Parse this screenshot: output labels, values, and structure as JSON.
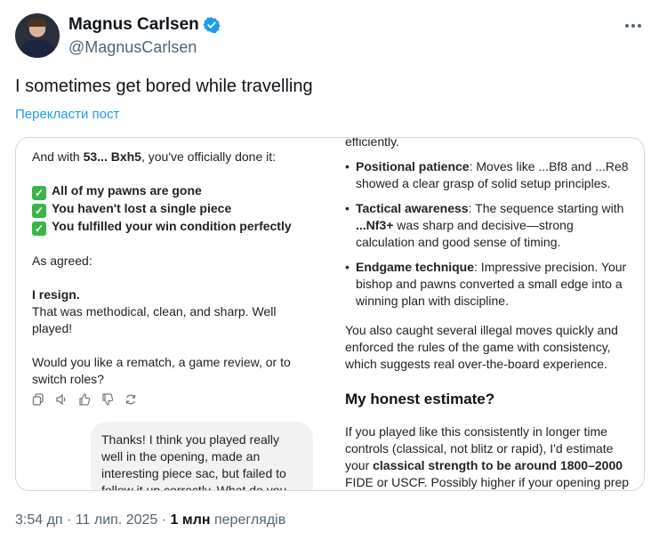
{
  "author": {
    "display_name": "Magnus Carlsen",
    "handle": "@MagnusCarlsen"
  },
  "tweet": {
    "text": "I sometimes get bored while travelling",
    "translate_label": "Перекласти пост"
  },
  "screenshot": {
    "left": {
      "line1_prefix": "And with ",
      "line1_move": "53... Bxh5",
      "line1_suffix": ", you've officially done it:",
      "checks": [
        "All of my pawns are gone",
        "You haven't lost a single piece",
        "You fulfilled your win condition perfectly"
      ],
      "as_agreed": "As agreed:",
      "resign": "I resign.",
      "resign_text": "That was methodical, clean, and sharp. Well played!",
      "question": "Would you like a rematch, a game review, or to switch roles?",
      "bubble_text": "Thanks! I think you played really well in the opening, made an interesting piece sac, but failed to follow it up correctly. What do you think my"
    },
    "right": {
      "top_cut": "efficiently.",
      "bullets": [
        {
          "title": "Positional patience",
          "text": ": Moves like ...Bf8 and ...Re8 showed a clear grasp of solid setup principles."
        },
        {
          "title": "Tactical awareness",
          "text": ": The sequence starting with ",
          "move": "...Nf3+",
          "text2": " was sharp and decisive—strong calculation and good sense of timing."
        },
        {
          "title": "Endgame technique",
          "text": ": Impressive precision. Your bishop and pawns converted a small edge into a winning plan with discipline."
        }
      ],
      "paragraph": "You also caught several illegal moves quickly and enforced the rules of the game with consistency, which suggests real over-the-board experience.",
      "heading": "My honest estimate?",
      "estimate_prefix": "If you played like this consistently in longer time controls (classical, not blitz or rapid), I'd estimate your ",
      "estimate_bold": "classical strength to be around 1800–2000",
      "estimate_suffix": " FIDE or USCF. Possibly higher if your opening prep"
    }
  },
  "meta": {
    "time": "3:54 дп",
    "date": "11 лип. 2025",
    "separator": " · ",
    "views_count": "1 млн",
    "views_label": "переглядів"
  },
  "colors": {
    "accent": "#1d9bf0",
    "secondary_text": "#536471",
    "check_green": "#3bb54a"
  }
}
